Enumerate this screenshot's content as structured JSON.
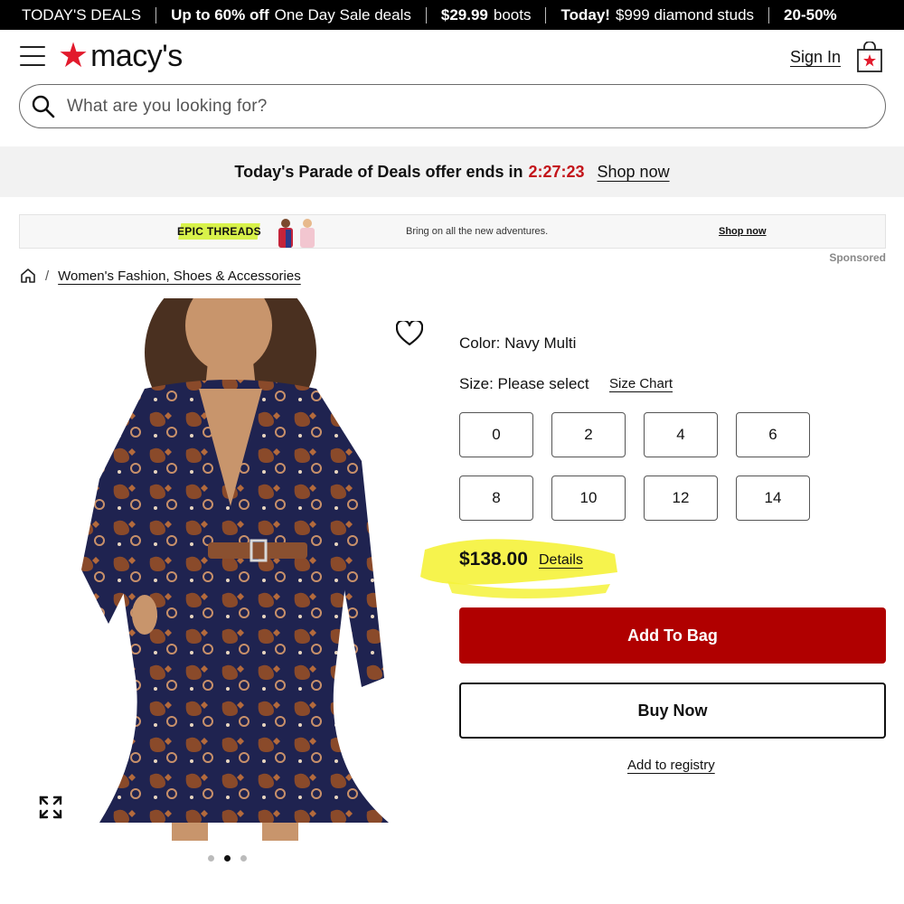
{
  "promo_bar": {
    "segments": [
      {
        "bold": "",
        "text": "TODAY'S DEALS"
      },
      {
        "bold": "Up to 60% off",
        "text": "One Day Sale deals"
      },
      {
        "bold": "$29.99",
        "text": "boots"
      },
      {
        "bold": "Today!",
        "text": "$999 diamond studs"
      },
      {
        "bold": "20-50%",
        "text": ""
      }
    ]
  },
  "header": {
    "logo_text": "macy's",
    "sign_in": "Sign In",
    "icons": {
      "menu": "hamburger-menu-icon",
      "bag": "shopping-bag-icon"
    }
  },
  "search": {
    "placeholder": "What are you looking for?",
    "icon": "search-icon"
  },
  "deals_banner": {
    "text": "Today's Parade of Deals offer ends in",
    "timer": "2:27:23",
    "link": "Shop now"
  },
  "sponsored_ad": {
    "brand": "EPIC THREADS",
    "tagline": "Bring on all the new adventures.",
    "link": "Shop now",
    "label": "Sponsored"
  },
  "breadcrumb": {
    "home_icon": "home-icon",
    "separator": "/",
    "category": "Women's Fashion, Shoes & Accessories"
  },
  "product": {
    "color_label": "Color: Navy Multi",
    "size_label": "Size: Please select",
    "size_chart": "Size Chart",
    "sizes": [
      "0",
      "2",
      "4",
      "6",
      "8",
      "10",
      "12",
      "14"
    ],
    "price": "$138.00",
    "details_link": "Details",
    "add_to_bag": "Add To Bag",
    "buy_now": "Buy Now",
    "add_to_registry": "Add to registry",
    "image_count": 3,
    "active_image": 2
  },
  "colors": {
    "brand_red": "#e21a2c",
    "timer_red": "#c3151b",
    "add_to_bag_bg": "#b00000",
    "highlight_yellow": "#f5f23a",
    "dress_navy": "#1f2350"
  }
}
